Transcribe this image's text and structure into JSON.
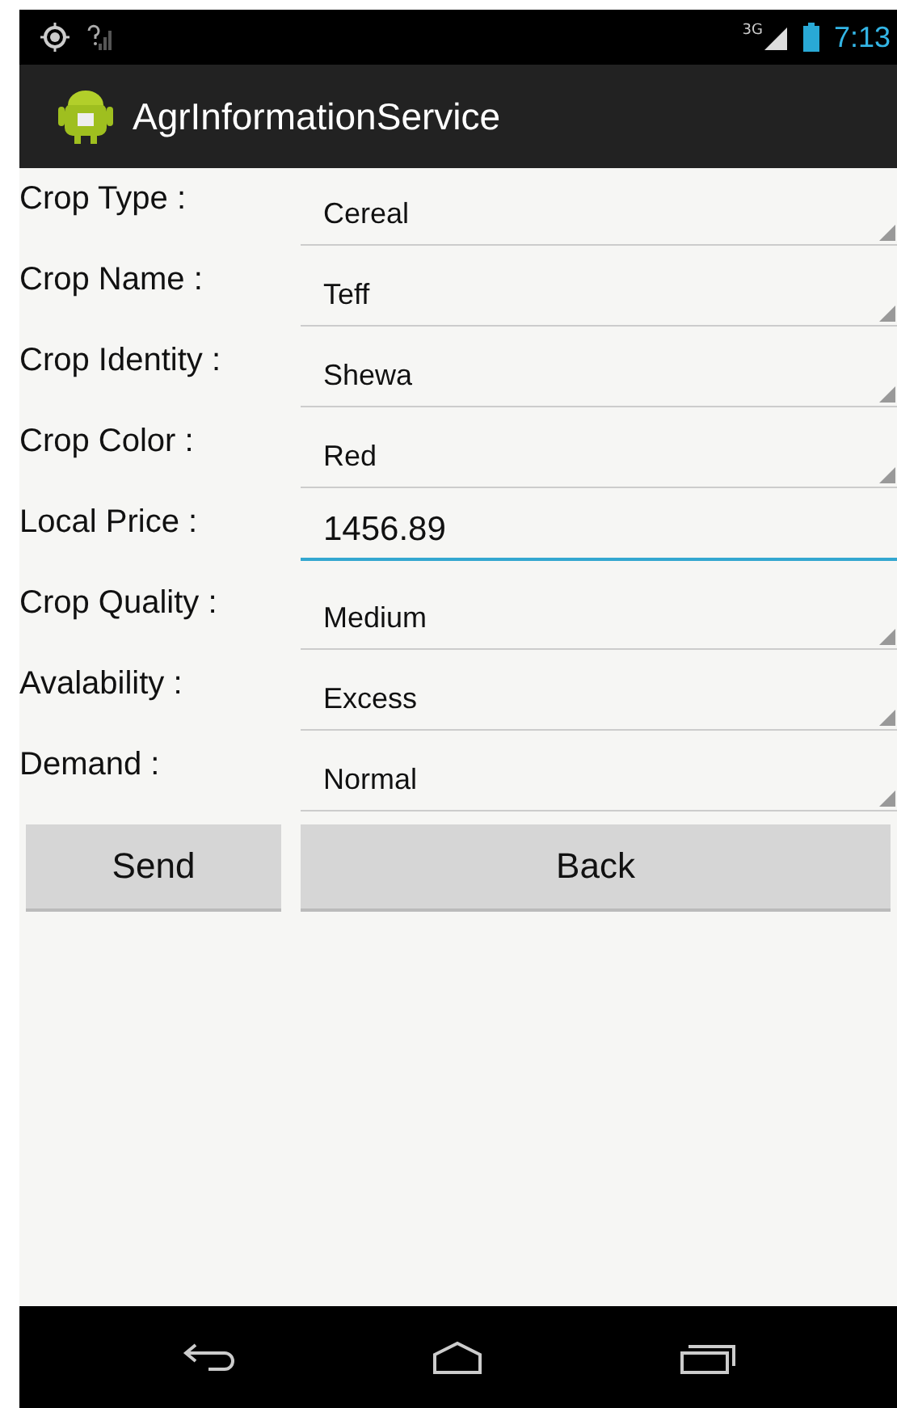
{
  "status_bar": {
    "time": "7:13",
    "network": "3G"
  },
  "action_bar": {
    "title": "AgrInformationService"
  },
  "fields": [
    {
      "label": "Crop Type :",
      "kind": "spinner",
      "value": "Cereal"
    },
    {
      "label": "Crop Name :",
      "kind": "spinner",
      "value": "Teff"
    },
    {
      "label": "Crop Identity :",
      "kind": "spinner",
      "value": "Shewa"
    },
    {
      "label": "Crop Color :",
      "kind": "spinner",
      "value": "Red"
    },
    {
      "label": "Local Price :",
      "kind": "text",
      "value": "1456.89",
      "focused": true
    },
    {
      "label": "Crop Quality :",
      "kind": "spinner",
      "value": "Medium"
    },
    {
      "label": "Avalability :",
      "kind": "spinner",
      "value": "Excess"
    },
    {
      "label": "Demand :",
      "kind": "spinner",
      "value": "Normal"
    }
  ],
  "buttons": [
    "Send",
    "Back"
  ]
}
